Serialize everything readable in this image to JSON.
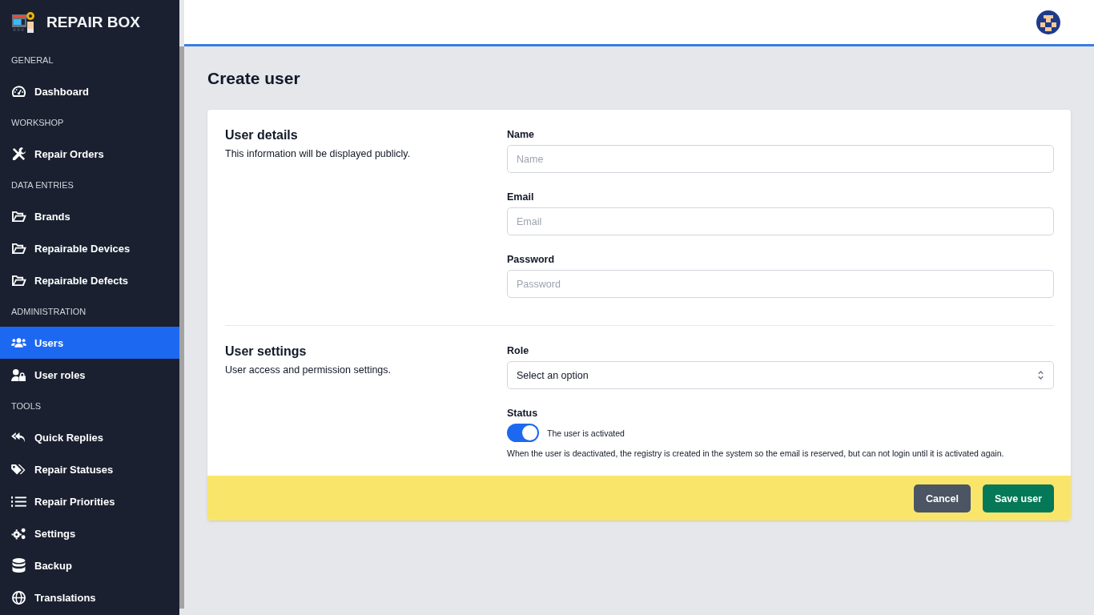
{
  "brand": {
    "name": "REPAIR BOX"
  },
  "sidebar": {
    "sections": [
      {
        "title": "GENERAL",
        "items": [
          {
            "label": "Dashboard",
            "selected": false
          }
        ]
      },
      {
        "title": "WORKSHOP",
        "items": [
          {
            "label": "Repair Orders",
            "selected": false
          }
        ]
      },
      {
        "title": "DATA ENTRIES",
        "items": [
          {
            "label": "Brands",
            "selected": false
          },
          {
            "label": "Repairable Devices",
            "selected": false
          },
          {
            "label": "Repairable Defects",
            "selected": false
          }
        ]
      },
      {
        "title": "ADMINISTRATION",
        "items": [
          {
            "label": "Users",
            "selected": true
          },
          {
            "label": "User roles",
            "selected": false
          }
        ]
      },
      {
        "title": "TOOLS",
        "items": [
          {
            "label": "Quick Replies",
            "selected": false
          },
          {
            "label": "Repair Statuses",
            "selected": false
          },
          {
            "label": "Repair Priorities",
            "selected": false
          },
          {
            "label": "Settings",
            "selected": false
          },
          {
            "label": "Backup",
            "selected": false
          },
          {
            "label": "Translations",
            "selected": false
          }
        ]
      }
    ]
  },
  "page": {
    "title": "Create user"
  },
  "sections": [
    {
      "title": "User details",
      "description": "This information will be displayed publicly.",
      "fields": [
        {
          "kind": "text",
          "label": "Name",
          "placeholder": "Name"
        },
        {
          "kind": "text",
          "label": "Email",
          "placeholder": "Email"
        },
        {
          "kind": "text",
          "label": "Password",
          "placeholder": "Password"
        }
      ]
    },
    {
      "title": "User settings",
      "description": "User access and permission settings.",
      "fields": [
        {
          "kind": "select",
          "label": "Role",
          "value": "Select an option"
        },
        {
          "kind": "toggle",
          "label": "Status",
          "on": true,
          "toggle_label": "The user is activated",
          "help": "When the user is deactivated, the registry is created in the system so the email is reserved, but can not login until it is activated again."
        }
      ]
    }
  ],
  "buttons": [
    {
      "label": "Cancel",
      "kind": "secondary"
    },
    {
      "label": "Save user",
      "kind": "primary"
    }
  ]
}
